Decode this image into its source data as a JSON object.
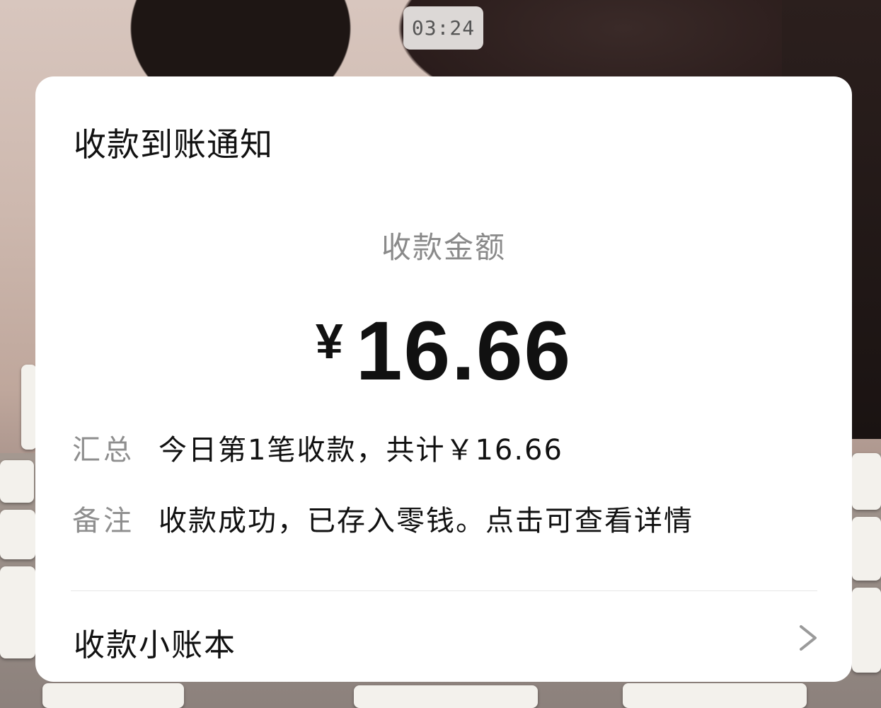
{
  "status": {
    "time": "03:24"
  },
  "card": {
    "title": "收款到账通知",
    "amount_label": "收款金额",
    "currency_symbol": "¥",
    "amount": "16.66",
    "summary": {
      "label": "汇总",
      "text": "今日第1笔收款，共计￥16.66"
    },
    "remark": {
      "label": "备注",
      "text": "收款成功，已存入零钱。点击可查看详情"
    },
    "footer": {
      "label": "收款小账本",
      "icon": "chevron-right-icon"
    }
  },
  "colors": {
    "card_background": "#ffffff",
    "primary_text": "#111111",
    "secondary_text": "#8e8e8e",
    "divider": "#e6e6e6"
  }
}
